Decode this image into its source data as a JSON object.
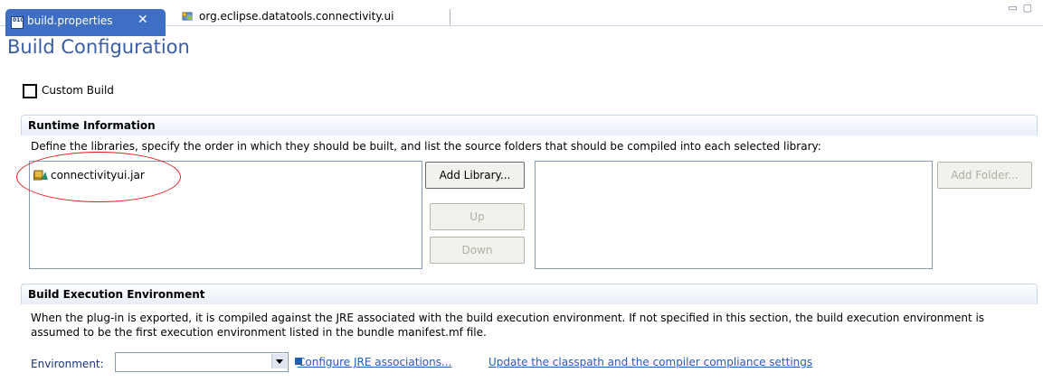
{
  "tabs": [
    {
      "label": "build.properties",
      "active": true,
      "icon": "properties-file-icon",
      "close": "✕"
    },
    {
      "label": "org.eclipse.datatools.connectivity.ui",
      "active": false,
      "icon": "plugin-icon"
    }
  ],
  "page": {
    "title": "Build Configuration",
    "custom_build_label": "Custom Build"
  },
  "runtime": {
    "header": "Runtime Information",
    "description": "Define the libraries, specify the order in which they should be built, and list the source folders that should be compiled into each selected library:",
    "libraries": [
      "connectivityui.jar"
    ],
    "buttons": {
      "add_library": "Add Library...",
      "up": "Up",
      "down": "Down",
      "add_folder": "Add Folder..."
    }
  },
  "build_env": {
    "header": "Build Execution Environment",
    "description": "When the plug-in is exported, it is compiled against the JRE associated with the build execution environment.  If not specified in this section, the build execution environment is assumed to be the first execution environment listed in the bundle manifest.mf file.",
    "environment_label": "Environment:",
    "environment_value": "",
    "configure_link": "Configure JRE associations...",
    "update_link": "Update the classpath and the compiler compliance settings"
  },
  "colors": {
    "title": "#3a5da8",
    "active_tab": "#3e6fc4",
    "link": "#1f5fb8",
    "highlight_ellipse": "#e0191a"
  }
}
